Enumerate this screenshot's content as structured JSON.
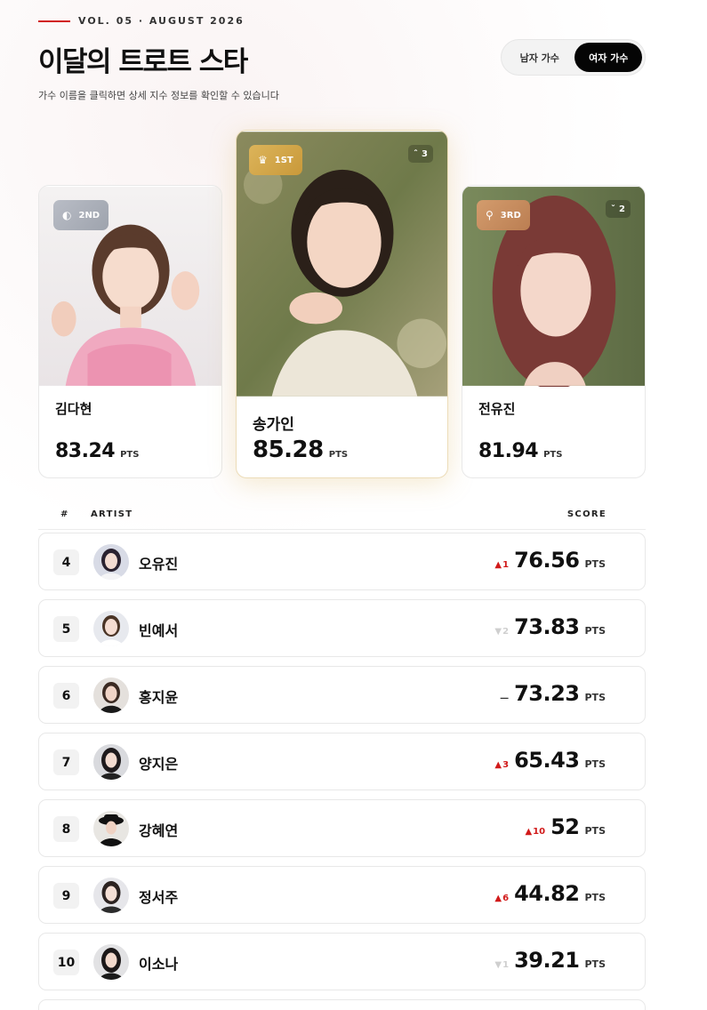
{
  "header": {
    "vol": "VOL. 05 · AUGUST 2026",
    "title": "이달의 트로트 스타",
    "subtitle": "가수 이름을 클릭하면 상세 지수 정보를 확인할 수 있습니다"
  },
  "toggle": {
    "male": "남자 가수",
    "female": "여자 가수",
    "active": "female"
  },
  "podium": {
    "first": {
      "badge": "1ST",
      "change": "3",
      "change_dir": "up",
      "name": "송가인",
      "score": "85.28",
      "unit": "PTS"
    },
    "second": {
      "badge": "2ND",
      "name": "김다현",
      "score": "83.24",
      "unit": "PTS"
    },
    "third": {
      "badge": "3RD",
      "change": "2",
      "change_dir": "down",
      "name": "전유진",
      "score": "81.94",
      "unit": "PTS"
    }
  },
  "table": {
    "headers": {
      "rank": "#",
      "artist": "ARTIST",
      "score": "SCORE"
    },
    "rows": [
      {
        "rank": "4",
        "name": "오유진",
        "change": "1",
        "dir": "up",
        "score": "76.56",
        "unit": "PTS"
      },
      {
        "rank": "5",
        "name": "빈예서",
        "change": "2",
        "dir": "down",
        "score": "73.83",
        "unit": "PTS"
      },
      {
        "rank": "6",
        "name": "홍지윤",
        "change": "",
        "dir": "same",
        "score": "73.23",
        "unit": "PTS"
      },
      {
        "rank": "7",
        "name": "양지은",
        "change": "3",
        "dir": "up",
        "score": "65.43",
        "unit": "PTS"
      },
      {
        "rank": "8",
        "name": "강혜연",
        "change": "10",
        "dir": "up",
        "score": "52",
        "unit": "PTS"
      },
      {
        "rank": "9",
        "name": "정서주",
        "change": "6",
        "dir": "up",
        "score": "44.82",
        "unit": "PTS"
      },
      {
        "rank": "10",
        "name": "이소나",
        "change": "1",
        "dir": "down",
        "score": "39.21",
        "unit": "PTS"
      }
    ]
  },
  "colors": {
    "accent": "#d11a1a",
    "gold": "#d6a94a",
    "silver": "#a9aeb8",
    "bronze": "#c98c5e",
    "dark": "#050505"
  },
  "icons": {
    "first": "crown-icon",
    "second": "medal-icon",
    "third": "ribbon-icon",
    "up": "triangle-up-icon",
    "down": "triangle-down-icon",
    "same": "dash-icon"
  }
}
